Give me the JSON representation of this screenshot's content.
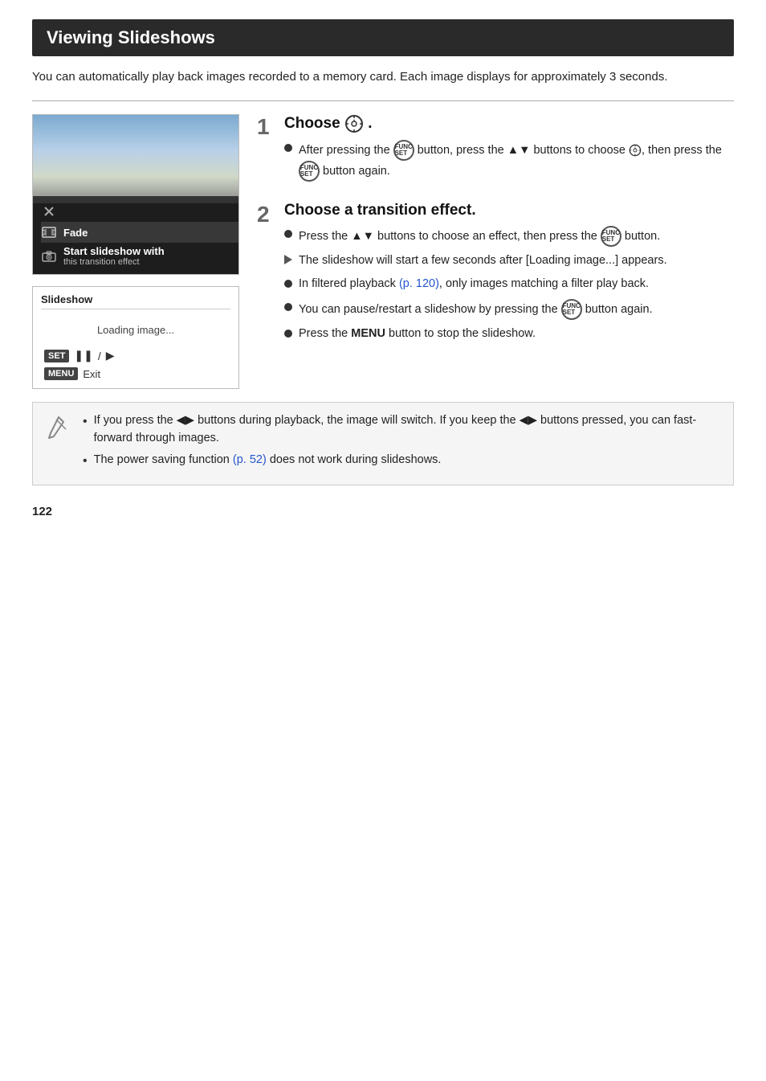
{
  "page": {
    "title": "Viewing Slideshows",
    "intro": "You can automatically play back images recorded to a memory card. Each image displays for approximately 3 seconds.",
    "page_number": "122"
  },
  "step1": {
    "number": "1",
    "title_prefix": "Choose",
    "title_icon": "slideshow-icon",
    "bullets": [
      {
        "type": "circle",
        "text_parts": [
          {
            "text": "After pressing the "
          },
          {
            "text": "FUNC/SET",
            "type": "icon"
          },
          {
            "text": " button, press the ▲▼ buttons to choose "
          },
          {
            "text": "slideshow-icon",
            "type": "icon"
          },
          {
            "text": ", then press the "
          },
          {
            "text": "FUNC/SET",
            "type": "icon"
          },
          {
            "text": " button again."
          }
        ]
      }
    ]
  },
  "step2": {
    "number": "2",
    "title": "Choose a transition effect.",
    "bullets": [
      {
        "type": "circle",
        "text": "Press the ▲▼ buttons to choose an effect, then press the FUNC/SET button."
      },
      {
        "type": "triangle",
        "text": "The slideshow will start a few seconds after [Loading image...] appears."
      },
      {
        "type": "circle",
        "text": "In filtered playback (p. 120), only images matching a filter play back.",
        "link_text": "p. 120"
      },
      {
        "type": "circle",
        "text": "You can pause/restart a slideshow by pressing the FUNC/SET button again."
      },
      {
        "type": "circle",
        "text": "Press the MENU button to stop the slideshow."
      }
    ]
  },
  "screenshot_top": {
    "menu_items": [
      {
        "icon": "x-icon",
        "label": "",
        "sublabel": ""
      },
      {
        "icon": "film-icon",
        "label": "Fade",
        "sublabel": ""
      },
      {
        "icon": "camera-icon",
        "label": "Start slideshow with",
        "sublabel": "this transition effect"
      }
    ]
  },
  "screenshot_bottom": {
    "title": "Slideshow",
    "loading_text": "Loading image...",
    "controls": "SET  ❚❚ /  ▶",
    "exit_label": "Exit"
  },
  "notes": [
    {
      "text_before": "If you press the ◀▶ buttons during playback, the image will switch. If you keep the ◀▶ buttons pressed, you can fast-forward through images."
    },
    {
      "text_before": "The power saving function (p. 52) does not work during slideshows.",
      "link_text": "p. 52"
    }
  ]
}
